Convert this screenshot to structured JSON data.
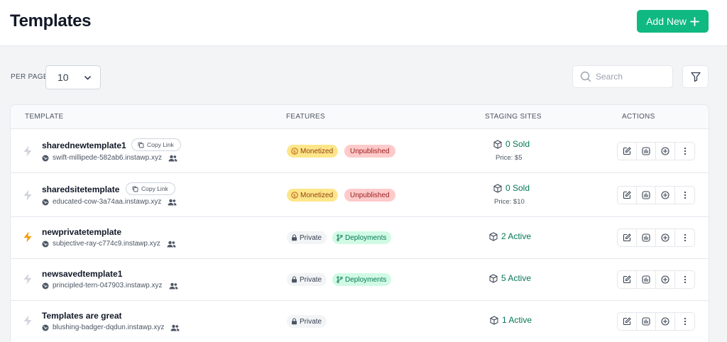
{
  "header": {
    "title": "Templates",
    "add_new_label": "Add New"
  },
  "controls": {
    "per_page_label": "PER PAGE",
    "per_page_value": "10",
    "search_placeholder": "Search"
  },
  "table": {
    "columns": [
      "TEMPLATE",
      "FEATURES",
      "STAGING SITES",
      "ACTIONS"
    ],
    "copy_link_label": "Copy Link",
    "rows": [
      {
        "name": "sharednewtemplate1",
        "domain": "swift-millipede-582ab6.instawp.xyz",
        "badges": [
          "Monetized",
          "Unpublished"
        ],
        "staging": "0 Sold",
        "price": "Price: $5"
      },
      {
        "name": "sharedsitetemplate",
        "domain": "educated-cow-3a74aa.instawp.xyz",
        "badges": [
          "Monetized",
          "Unpublished"
        ],
        "staging": "0 Sold",
        "price": "Price: $10"
      },
      {
        "name": "newprivatetemplate",
        "domain": "subjective-ray-c774c9.instawp.xyz",
        "badges": [
          "Private",
          "Deployments"
        ],
        "staging": "2 Active"
      },
      {
        "name": "newsavedtemplate1",
        "domain": "principled-tern-047903.instawp.xyz",
        "badges": [
          "Private",
          "Deployments"
        ],
        "staging": "5 Active"
      },
      {
        "name": "Templates are great",
        "domain": "blushing-badger-dqdun.instawp.xyz",
        "badges": [
          "Private"
        ],
        "staging": "1 Active"
      }
    ]
  },
  "colors": {
    "accent": "#10b981",
    "active_bolt": "#f59e0b",
    "inactive_bolt": "#d1d5db",
    "staging_text": "#047857"
  },
  "icons": [
    "plus-icon",
    "chevron-down-icon",
    "search-icon",
    "filter-icon",
    "bolt-icon",
    "copy-icon",
    "globe-icon",
    "users-icon",
    "coin-icon",
    "branch-icon",
    "box-icon",
    "edit-icon",
    "chart-icon",
    "plus-circle-icon",
    "more-vertical-icon"
  ]
}
